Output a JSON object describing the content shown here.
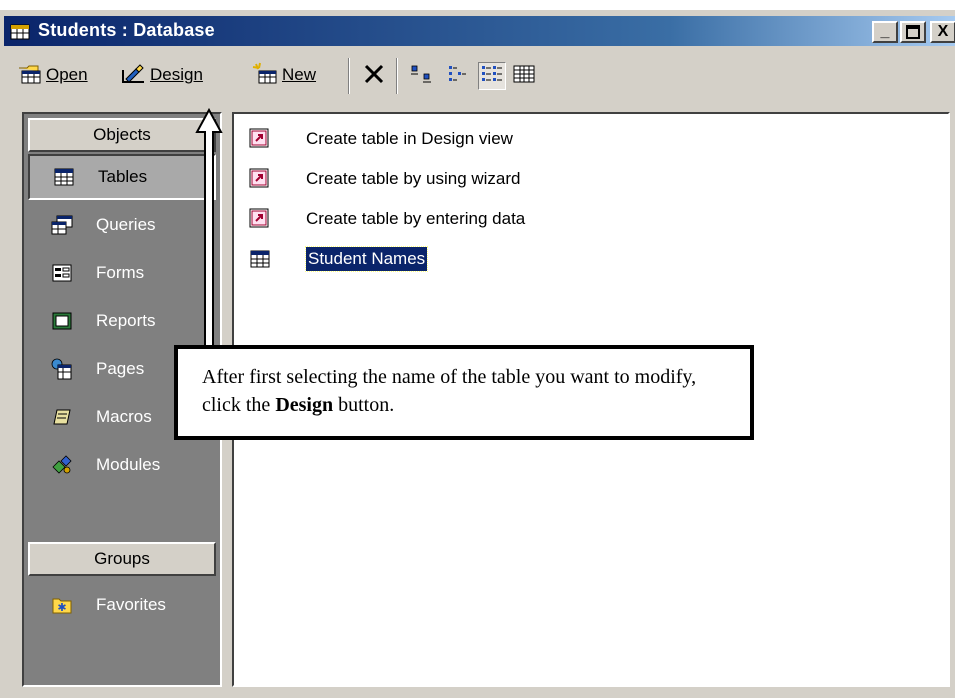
{
  "window": {
    "title": "Students : Database",
    "min_label": "_",
    "max_label": "□",
    "close_label": "X"
  },
  "toolbar": {
    "open_label": "Open",
    "design_label": "Design",
    "new_label": "New"
  },
  "objects_bar": {
    "objects_header": "Objects",
    "items": [
      {
        "label": "Tables",
        "icon": "table-icon"
      },
      {
        "label": "Queries",
        "icon": "query-icon"
      },
      {
        "label": "Forms",
        "icon": "form-icon"
      },
      {
        "label": "Reports",
        "icon": "report-icon"
      },
      {
        "label": "Pages",
        "icon": "page-icon"
      },
      {
        "label": "Macros",
        "icon": "macro-icon"
      },
      {
        "label": "Modules",
        "icon": "module-icon"
      }
    ],
    "groups_header": "Groups",
    "groups": [
      {
        "label": "Favorites",
        "icon": "favorites-icon"
      }
    ]
  },
  "list": {
    "items": [
      {
        "label": "Create table in Design view",
        "icon": "shortcut-icon"
      },
      {
        "label": "Create table by using wizard",
        "icon": "shortcut-icon"
      },
      {
        "label": "Create table by entering data",
        "icon": "shortcut-icon"
      },
      {
        "label": "Student Names",
        "icon": "table-icon",
        "selected": true
      }
    ]
  },
  "callout": {
    "text_before": "After first selecting the name of the table you want to modify, click the ",
    "bold": "Design",
    "text_after": " button."
  },
  "colors": {
    "title_gradient_start": "#0a246a",
    "selection": "#0a246a",
    "face": "#d4d0c8"
  }
}
